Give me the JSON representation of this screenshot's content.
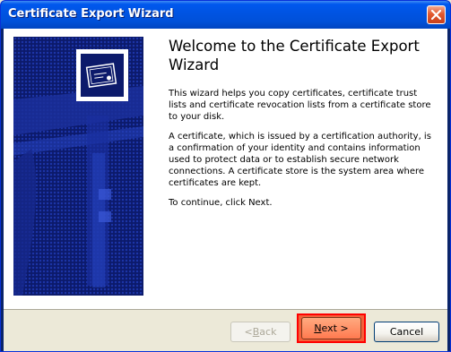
{
  "window": {
    "title": "Certificate Export Wizard",
    "close_icon": "close-icon"
  },
  "banner": {
    "icon": "certificate-icon"
  },
  "content": {
    "heading": "Welcome to the Certificate Export Wizard",
    "paragraphs": [
      "This wizard helps you copy certificates, certificate trust lists and certificate revocation lists from a certificate store to your disk.",
      "A certificate, which is issued by a certification authority, is a confirmation of your identity and contains information used to protect data or to establish secure network connections. A certificate store is the system area where certificates are kept.",
      "To continue, click Next."
    ]
  },
  "buttons": {
    "back_pre": "< ",
    "back_key": "B",
    "back_post": "ack",
    "next_key": "N",
    "next_post": "ext >",
    "cancel": "Cancel"
  },
  "colors": {
    "titlebar": "#0054e3",
    "banner": "#0c1a6b",
    "highlight": "#ff0000"
  }
}
